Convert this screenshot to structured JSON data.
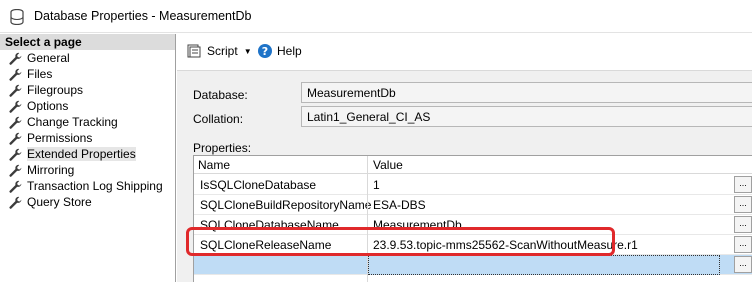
{
  "window": {
    "title": "Database Properties - MeasurementDb"
  },
  "left_pane": {
    "header": "Select a page",
    "items": [
      {
        "label": "General"
      },
      {
        "label": "Files"
      },
      {
        "label": "Filegroups"
      },
      {
        "label": "Options"
      },
      {
        "label": "Change Tracking"
      },
      {
        "label": "Permissions"
      },
      {
        "label": "Extended Properties"
      },
      {
        "label": "Mirroring"
      },
      {
        "label": "Transaction Log Shipping"
      },
      {
        "label": "Query Store"
      }
    ]
  },
  "toolbar": {
    "script_label": "Script",
    "help_label": "Help"
  },
  "form": {
    "database_label": "Database:",
    "database_value": "MeasurementDb",
    "collation_label": "Collation:",
    "collation_value": "Latin1_General_CI_AS",
    "properties_label": "Properties:"
  },
  "grid": {
    "col_name": "Name",
    "col_value": "Value",
    "ellipsis": "...",
    "rows": [
      {
        "name": "IsSQLCloneDatabase",
        "value": "1"
      },
      {
        "name": "SQLCloneBuildRepositoryName",
        "value": "ESA-DBS"
      },
      {
        "name": "SQLCloneDatabaseName",
        "value": "MeasurementDb"
      },
      {
        "name": "SQLCloneReleaseName",
        "value": "23.9.53.topic-mms25562-ScanWithoutMeasure.r1"
      }
    ]
  },
  "colors": {
    "highlight": "#e0292b",
    "selection": "#bfdcf5"
  }
}
